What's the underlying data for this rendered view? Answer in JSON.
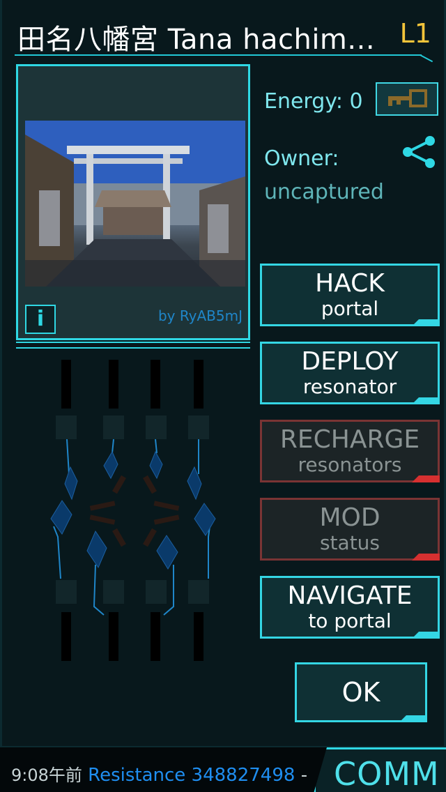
{
  "portal": {
    "title": "田名八幡宮 Tana hachim...",
    "level": "L1",
    "photo_credit": "by RyAB5mJ",
    "info_button": "i"
  },
  "status": {
    "energy": "Energy: 0",
    "owner_label": "Owner:",
    "owner_value": "uncaptured"
  },
  "actions": [
    {
      "big": "HACK",
      "small": "portal",
      "enabled": true
    },
    {
      "big": "DEPLOY",
      "small": "resonator",
      "enabled": true
    },
    {
      "big": "RECHARGE",
      "small": "resonators",
      "enabled": false
    },
    {
      "big": "MOD",
      "small": "status",
      "enabled": false
    },
    {
      "big": "NAVIGATE",
      "small": "to portal",
      "enabled": true
    }
  ],
  "ok_label": "OK",
  "comm": {
    "time": "9:08午前",
    "faction": "Resistance",
    "score": "348827498",
    "separator": "-",
    "tab_label": "COMM"
  },
  "colors": {
    "accent": "#2fd8e4",
    "level": "#f2c43a",
    "disabled_accent": "#d63030",
    "resistance": "#1f8ef0"
  },
  "icons": {
    "key": "key-icon",
    "share": "share-icon",
    "info": "info-icon"
  }
}
